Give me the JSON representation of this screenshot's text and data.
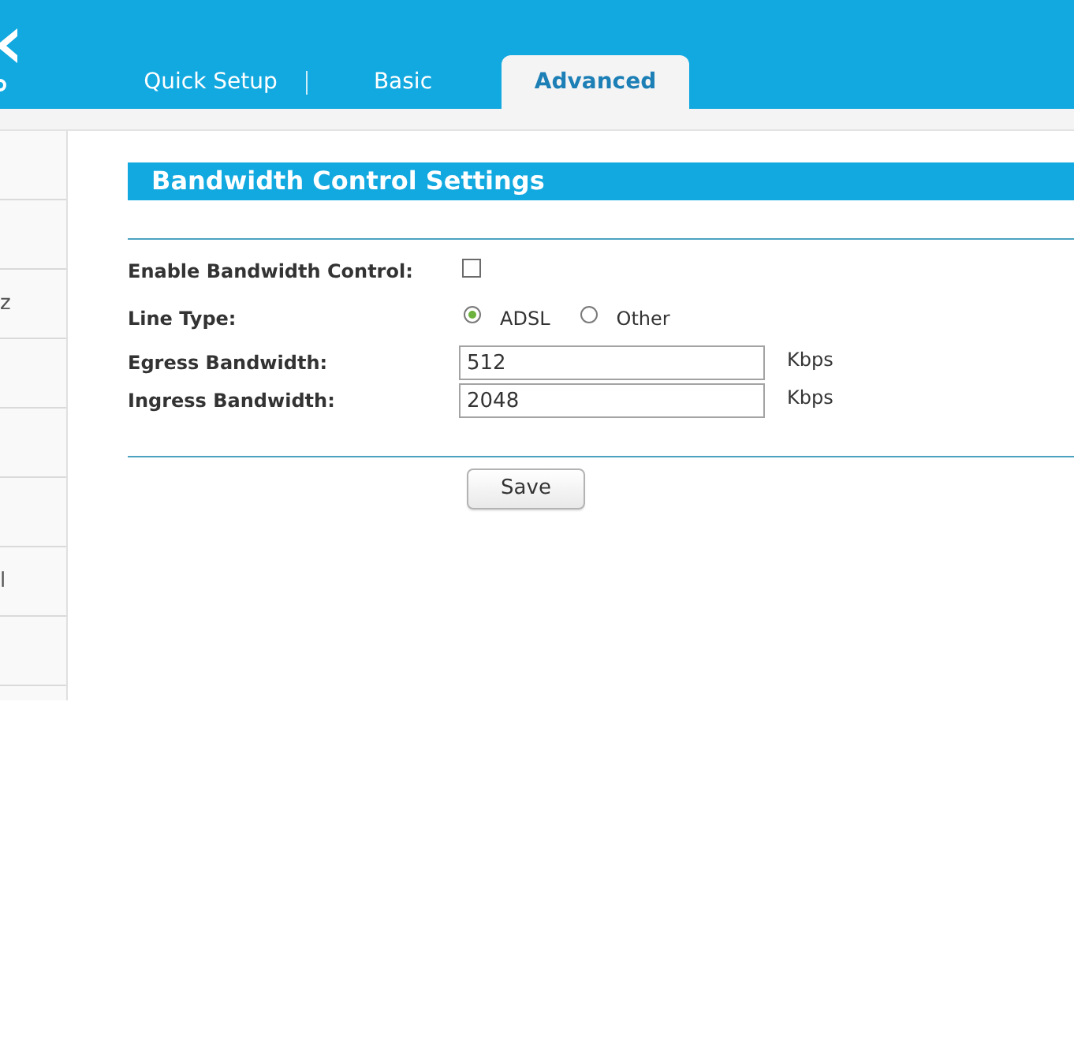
{
  "header": {
    "tabs": [
      {
        "label": "Quick Setup",
        "selected": false
      },
      {
        "label": "Basic",
        "selected": false
      },
      {
        "label": "Advanced",
        "selected": true
      }
    ]
  },
  "sidebar": {
    "items": [
      {
        "kind": "blank"
      },
      {
        "kind": "blank"
      },
      {
        "kind": "text",
        "label": "z"
      },
      {
        "kind": "blank"
      },
      {
        "kind": "blank"
      },
      {
        "kind": "blank"
      },
      {
        "kind": "text",
        "label": "l"
      },
      {
        "kind": "blank"
      }
    ]
  },
  "section": {
    "title": "Bandwidth Control Settings",
    "fields": [
      {
        "kind": "checkbox",
        "label": "Enable Bandwidth Control:",
        "checked": false
      },
      {
        "kind": "radio",
        "label": "Line Type:",
        "options": [
          {
            "label": "ADSL",
            "selected": true
          },
          {
            "label": "Other",
            "selected": false
          }
        ]
      },
      {
        "kind": "input",
        "label": "Egress Bandwidth:",
        "value": "512",
        "unit": "Kbps"
      },
      {
        "kind": "input",
        "label": "Ingress Bandwidth:",
        "value": "2048",
        "unit": "Kbps"
      }
    ],
    "buttons": [
      "Save"
    ]
  }
}
